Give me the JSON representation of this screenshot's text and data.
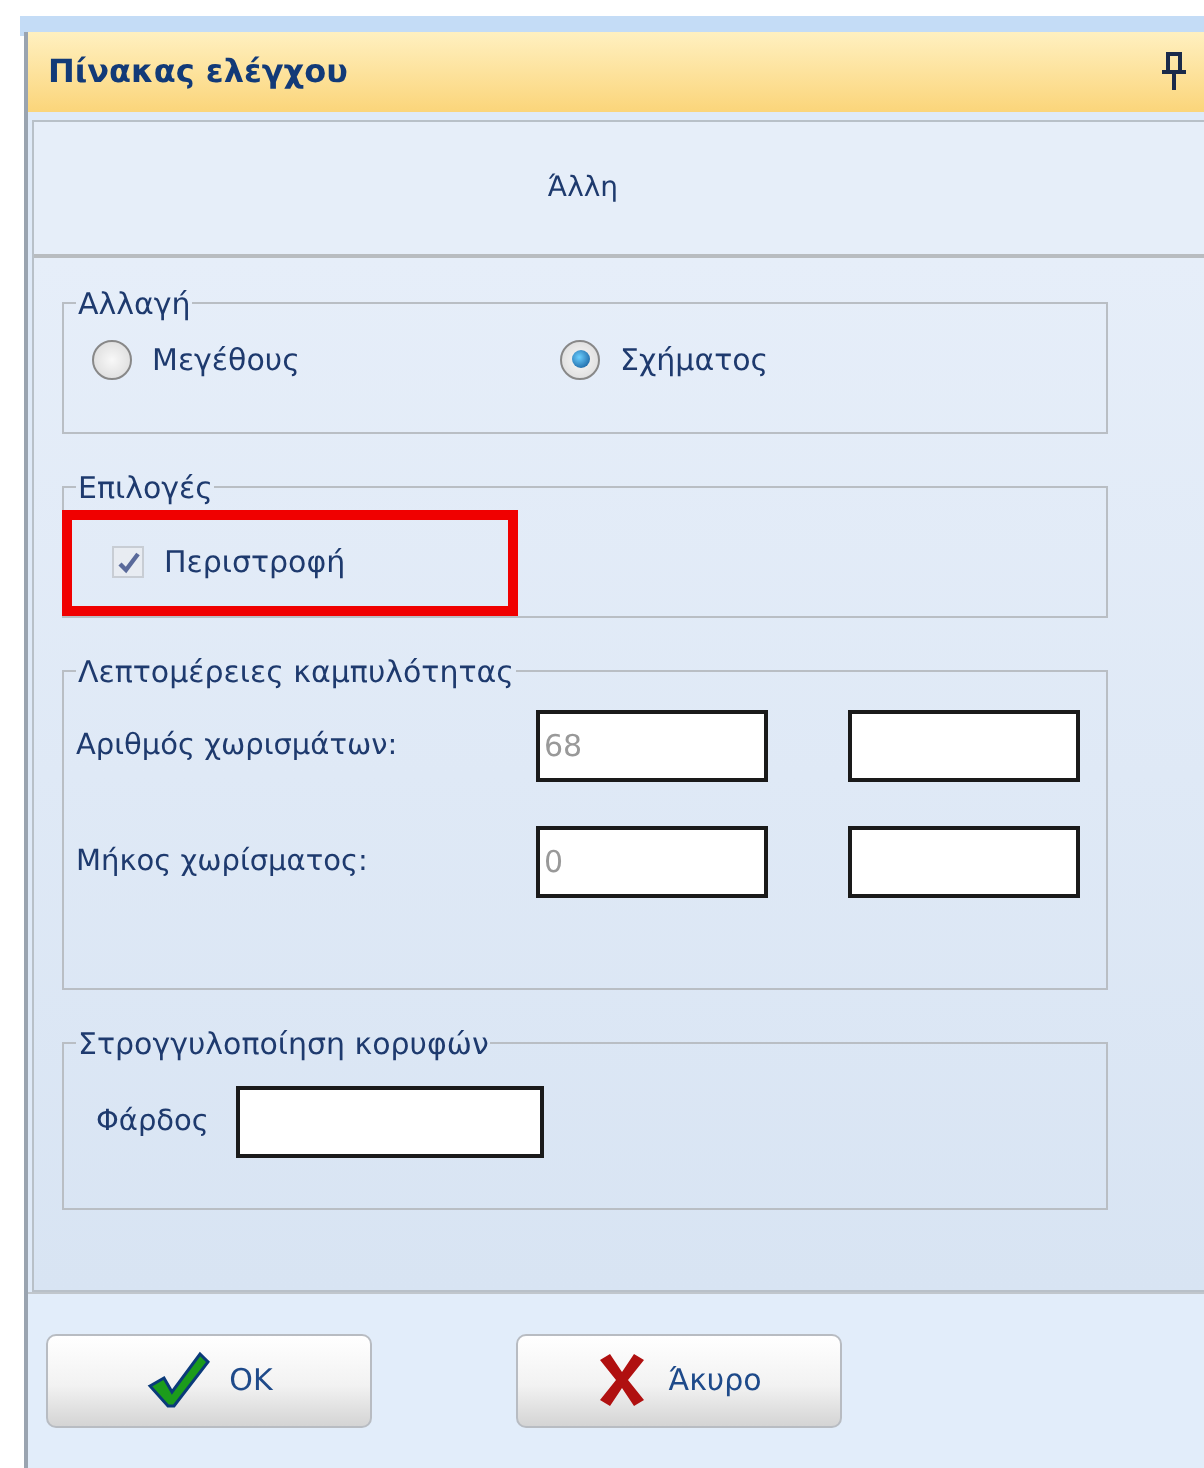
{
  "window": {
    "title": "Πίνακας ελέγχου"
  },
  "header": {
    "label": "Άλλη"
  },
  "groups": [
    {
      "kind": "radios",
      "title": "Αλλαγή",
      "options": [
        {
          "label": "Μεγέθους",
          "selected": false
        },
        {
          "label": "Σχήματος",
          "selected": true
        }
      ]
    },
    {
      "kind": "checks",
      "title": "Επιλογές",
      "options": [
        {
          "label": "Περιστροφή",
          "checked": true,
          "disabled": true,
          "highlighted": true
        }
      ]
    },
    {
      "kind": "fields",
      "title": "Λεπτομέρειες καμπυλότητας",
      "rows": [
        {
          "label": "Αριθμός χωρισμάτων:",
          "fields": [
            {
              "kind": "text",
              "value": "68",
              "disabled": true
            },
            {
              "kind": "text"
            }
          ]
        },
        {
          "label": "Μήκος χωρίσματος:",
          "fields": [
            {
              "kind": "text",
              "value": "0",
              "disabled": true
            },
            {
              "kind": "text"
            }
          ]
        }
      ]
    },
    {
      "kind": "inline",
      "title": "Στρογγυλοποίηση κορυφών",
      "rows": [
        {
          "label": "Φάρδος",
          "fields": [
            {
              "kind": "text"
            }
          ]
        }
      ]
    }
  ],
  "buttons": [
    {
      "kind": "ok",
      "label": "OK"
    },
    {
      "kind": "cancel",
      "label": "Άκυρο"
    }
  ]
}
